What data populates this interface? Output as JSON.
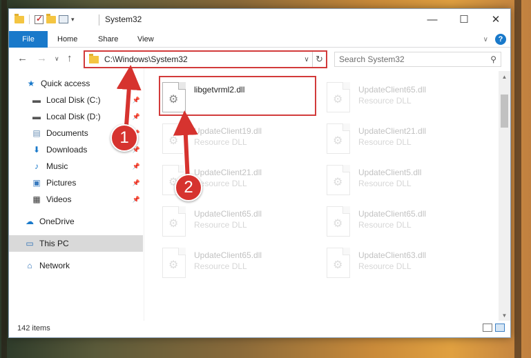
{
  "window": {
    "title": "System32",
    "controls": {
      "minimize": "—",
      "maximize": "☐",
      "close": "✕"
    }
  },
  "ribbon": {
    "file_tab": "File",
    "tabs": [
      "Home",
      "Share",
      "View"
    ]
  },
  "address_bar": {
    "path": "C:\\Windows\\System32",
    "search_placeholder": "Search System32"
  },
  "sidebar": {
    "items": [
      {
        "label": "Quick access",
        "icon": "star-icon",
        "pinned": false
      },
      {
        "label": "Local Disk (C:)",
        "icon": "drive-icon",
        "pinned": true
      },
      {
        "label": "Local Disk (D:)",
        "icon": "drive-icon",
        "pinned": true
      },
      {
        "label": "Documents",
        "icon": "documents-icon",
        "pinned": true
      },
      {
        "label": "Downloads",
        "icon": "download-icon",
        "pinned": true
      },
      {
        "label": "Music",
        "icon": "music-icon",
        "pinned": true
      },
      {
        "label": "Pictures",
        "icon": "pictures-icon",
        "pinned": true
      },
      {
        "label": "Videos",
        "icon": "videos-icon",
        "pinned": true
      },
      {
        "label": "OneDrive",
        "icon": "cloud-icon",
        "pinned": false
      },
      {
        "label": "This PC",
        "icon": "computer-icon",
        "pinned": false,
        "selected": true
      },
      {
        "label": "Network",
        "icon": "network-icon",
        "pinned": false
      }
    ]
  },
  "files": [
    {
      "name": "libgetvrml2.dll",
      "type": "",
      "highlighted": true
    },
    {
      "name": "UpdateClient65.dll",
      "type": "Resource DLL"
    },
    {
      "name": "UpdateClient19.dll",
      "type": "Resource DLL"
    },
    {
      "name": "UpdateClient21.dll",
      "type": "Resource DLL"
    },
    {
      "name": "UpdateClient21.dll",
      "type": "Resource DLL"
    },
    {
      "name": "UpdateClient5.dll",
      "type": "Resource DLL"
    },
    {
      "name": "UpdateClient65.dll",
      "type": "Resource DLL"
    },
    {
      "name": "UpdateClient65.dll",
      "type": "Resource DLL"
    },
    {
      "name": "UpdateClient65.dll",
      "type": "Resource DLL"
    },
    {
      "name": "UpdateClient63.dll",
      "type": "Resource DLL"
    }
  ],
  "status": {
    "item_count": "142 items"
  },
  "callouts": [
    "1",
    "2"
  ],
  "colors": {
    "accent": "#1979ca",
    "callout": "#d6332f",
    "highlight_border": "#d23a3a"
  }
}
